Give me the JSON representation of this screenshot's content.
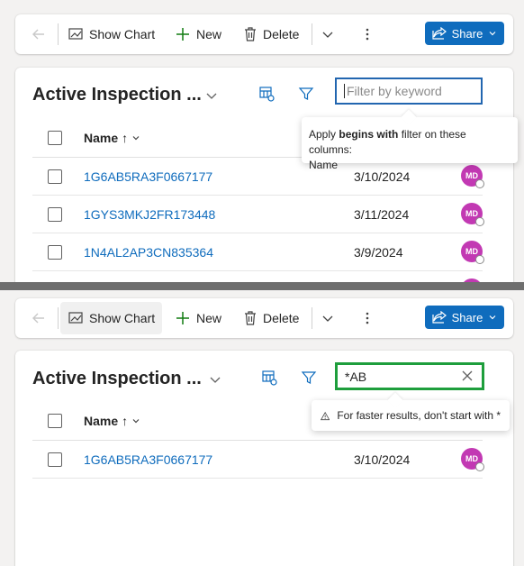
{
  "toolbar": {
    "show_chart_label": "Show Chart",
    "new_label": "New",
    "delete_label": "Delete",
    "share_label": "Share"
  },
  "view": {
    "title": "Active Inspection ...",
    "column_name": "Name",
    "sort_indicator": "↑"
  },
  "top_panel": {
    "search_placeholder": "Filter by keyword",
    "tooltip_prefix": "Apply ",
    "tooltip_bold": "begins with",
    "tooltip_suffix": " filter on these columns:",
    "tooltip_column": "Name",
    "rows": [
      {
        "name": "1G6AB5RA3F0667177",
        "date": "3/10/2024",
        "owner": "MD"
      },
      {
        "name": "1GYS3MKJ2FR173448",
        "date": "3/11/2024",
        "owner": "MD"
      },
      {
        "name": "1N4AL2AP3CN835364",
        "date": "3/9/2024",
        "owner": "MD"
      }
    ]
  },
  "bottom_panel": {
    "search_value": "*AB",
    "tooltip_warning": "For faster results, don't start with *",
    "rows": [
      {
        "name": "1G6AB5RA3F0667177",
        "date": "3/10/2024",
        "owner": "MD"
      }
    ]
  },
  "colors": {
    "brand": "#0f6cbd",
    "avatar": "#c239b3",
    "highlight_border": "#1e9e3c",
    "focus_border": "#2266b0"
  }
}
